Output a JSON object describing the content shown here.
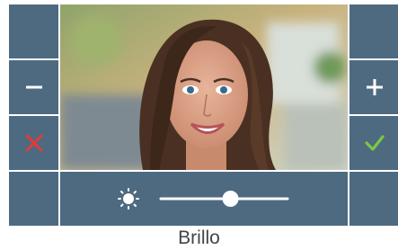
{
  "caption": "Brillo",
  "setting": {
    "name": "Brillo",
    "level": 0.55
  },
  "colors": {
    "panel": "#4e6a80",
    "cancel": "#e23a3a",
    "confirm": "#7ac943",
    "icon": "#ffffff"
  },
  "icons": {
    "decrease": "minus-icon",
    "increase": "plus-icon",
    "cancel": "close-icon",
    "confirm": "check-icon",
    "brightness": "sun-icon"
  }
}
